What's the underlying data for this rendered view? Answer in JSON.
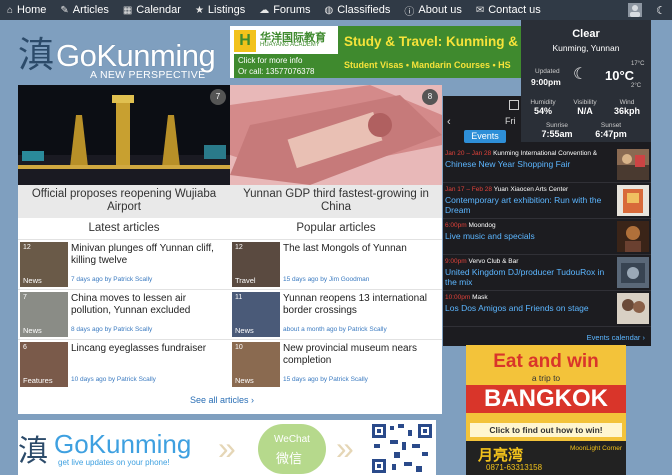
{
  "nav": {
    "items": [
      {
        "icon": "home-icon",
        "glyph": "⌂",
        "label": "Home"
      },
      {
        "icon": "pen-icon",
        "glyph": "✎",
        "label": "Articles"
      },
      {
        "icon": "calendar-icon",
        "glyph": "▦",
        "label": "Calendar"
      },
      {
        "icon": "star-icon",
        "glyph": "★",
        "label": "Listings"
      },
      {
        "icon": "chat-icon",
        "glyph": "☁",
        "label": "Forums"
      },
      {
        "icon": "globe-icon",
        "glyph": "◍",
        "label": "Classifieds"
      },
      {
        "icon": "info-icon",
        "glyph": "ⓘ",
        "label": "About us"
      },
      {
        "icon": "mail-icon",
        "glyph": "✉",
        "label": "Contact us"
      }
    ],
    "moon_glyph": "☾"
  },
  "logo": {
    "glyph": "滇",
    "name_a": "Go",
    "name_b": "Kunming",
    "tagline": "A NEW PERSPECTIVE"
  },
  "banner": {
    "cn": "华洋国际教育",
    "en": "HUAYANG ACADEMY",
    "click": "Click for more info",
    "call": "Or call: 13577076378",
    "title": "Study & Travel: Kunming &",
    "sub": "Student Visas • Mandarin Courses • HS"
  },
  "weather": {
    "condition": "Clear",
    "city": "Kunming, Yunnan",
    "updated_label": "Updated",
    "updated": "9:00pm",
    "moon_glyph": "☾",
    "temp": "10°C",
    "high": "17°C",
    "low": "2°C",
    "stats": [
      {
        "label": "Humidity",
        "value": "54%"
      },
      {
        "label": "Visibility",
        "value": "N/A"
      },
      {
        "label": "Wind",
        "value": "36kph"
      },
      {
        "label": "Sunrise",
        "value": "7:55am"
      },
      {
        "label": "Sunset",
        "value": "6:47pm"
      }
    ]
  },
  "events": {
    "day": "Fri",
    "tab": "Events",
    "prev_glyph": "‹",
    "calendar_link": "Events calendar  ›",
    "items": [
      {
        "date": "Jan 20 – Jan 28",
        "venue": "Kunming International Convention &",
        "title": "Chinese New Year Shopping Fair"
      },
      {
        "date": "Jan 17 – Feb 28",
        "venue": "Yuan Xiaocen Arts Center",
        "title": "Contemporary art exhibition: Run with the Dream"
      },
      {
        "date": "6:00pm",
        "venue": "Moondog",
        "title": "Live music and specials"
      },
      {
        "date": "9:00pm",
        "venue": "Vervo Club & Bar",
        "title": "United Kingdom DJ/producer TudouRox in the mix"
      },
      {
        "date": "10:00pm",
        "venue": "Mask",
        "title": "Los Dos Amigos and Friends on stage"
      }
    ]
  },
  "features": [
    {
      "num": "7",
      "caption": "Official proposes reopening Wujiaba Airport"
    },
    {
      "num": "8",
      "caption": "Yunnan GDP third fastest-growing in China"
    }
  ],
  "latest": {
    "heading": "Latest articles",
    "items": [
      {
        "num": "12",
        "cat": "News",
        "title": "Minivan plunges off Yunnan cliff, killing twelve",
        "meta": "7 days ago by Patrick Scally"
      },
      {
        "num": "7",
        "cat": "News",
        "title": "China moves to lessen air pollution, Yunnan excluded",
        "meta": "8 days ago by Patrick Scally"
      },
      {
        "num": "6",
        "cat": "Features",
        "title": "Lincang eyeglasses fundraiser",
        "meta": "10 days ago by Patrick Scally"
      }
    ]
  },
  "popular": {
    "heading": "Popular articles",
    "items": [
      {
        "num": "12",
        "cat": "Travel",
        "title": "The last Mongols of Yunnan",
        "meta": "15 days ago by Jim Goodman"
      },
      {
        "num": "11",
        "cat": "News",
        "title": "Yunnan reopens 13 international border crossings",
        "meta": "about a month ago by Patrick Scally"
      },
      {
        "num": "10",
        "cat": "News",
        "title": "New provincial museum nears completion",
        "meta": "15 days ago by Patrick Scally"
      }
    ]
  },
  "see_all": "See all articles  ›",
  "bottom": {
    "glyph": "滇",
    "name": "GoKunming",
    "tag": "get live updates on your phone!",
    "chev": "»",
    "wechat_en": "WeChat",
    "wechat_cn": "微信"
  },
  "ad": {
    "eat": "Eat and win",
    "trip": "a trip to",
    "city": "BANGKOK",
    "find": "Click to find out how to win!",
    "brand_cn": "月亮湾",
    "brand_en": "MoonLight Corner",
    "phone": "0871-63313158"
  }
}
